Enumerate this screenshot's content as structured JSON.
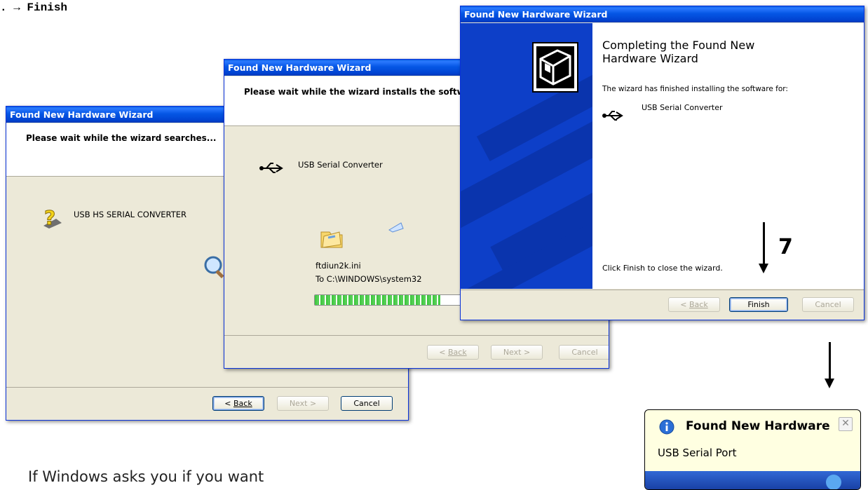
{
  "step_title": ". → Finish",
  "footer_text": "If Windows asks you if you want",
  "window1": {
    "title": "Found New Hardware Wizard",
    "header": "Please wait while the wizard searches...",
    "device": "USB HS SERIAL CONVERTER",
    "back": "Back",
    "next": "Next >",
    "cancel": "Cancel"
  },
  "window2": {
    "title": "Found New Hardware Wizard",
    "header": "Please wait while the wizard installs the softwa",
    "device": "USB Serial Converter",
    "file": "ftdiun2k.ini",
    "dest": "To C:\\WINDOWS\\system32",
    "back": "Back",
    "next": "Next >",
    "cancel": "Cancel",
    "progress": 0.85
  },
  "window3": {
    "title": "Found New Hardware Wizard",
    "heading": "Completing the Found New Hardware Wizard",
    "desc": "The wizard has finished installing the software for:",
    "device": "USB Serial Converter",
    "close_hint": "Click Finish to close the wizard.",
    "back": "Back",
    "finish": "Finish",
    "cancel": "Cancel"
  },
  "annotation_step": "7",
  "balloon": {
    "title": "Found New Hardware",
    "message": "USB Serial Port"
  }
}
